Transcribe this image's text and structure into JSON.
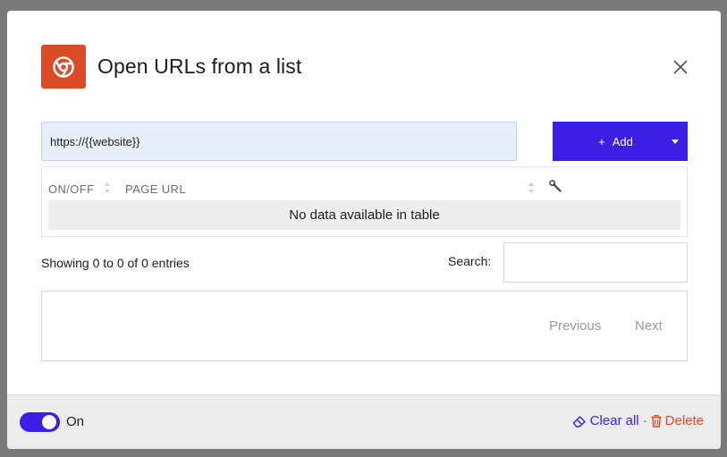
{
  "dialog": {
    "title": "Open URLs from a list",
    "app_icon": "chrome-icon",
    "close_icon": "close-icon"
  },
  "url_input": {
    "value": "https://{{website}}"
  },
  "add_button": {
    "label": "Add",
    "icon": "plus-icon",
    "dropdown_icon": "caret-down-icon"
  },
  "table": {
    "columns": [
      "ON/OFF",
      "PAGE URL"
    ],
    "settings_icon": "wrench-icon",
    "empty_message": "No data available in table"
  },
  "info": "Showing 0 to 0 of 0 entries",
  "search": {
    "label": "Search:",
    "value": ""
  },
  "pagination": {
    "previous": "Previous",
    "next": "Next"
  },
  "footer": {
    "toggle_label": "On",
    "toggle_on": true,
    "clear_label": "Clear all",
    "separator": "·",
    "delete_label": "Delete"
  },
  "colors": {
    "accent": "#3d1ee6",
    "brand": "#db4b28",
    "danger": "#e04a2c"
  }
}
